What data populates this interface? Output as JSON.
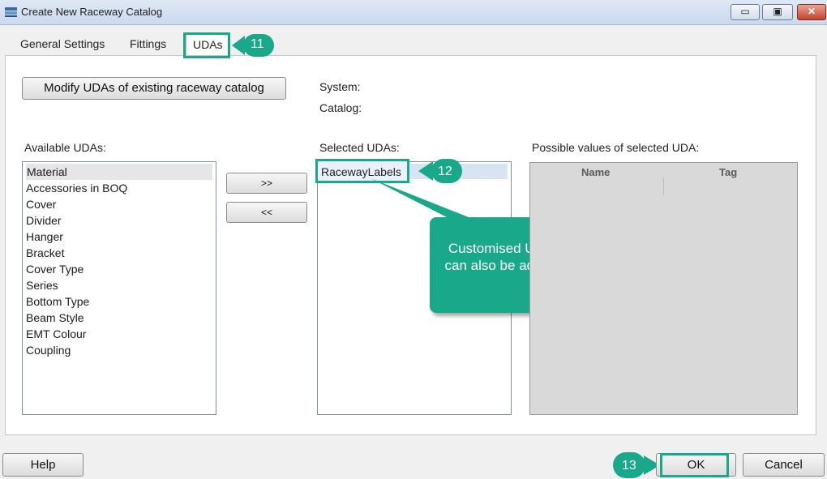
{
  "window": {
    "title": "Create New Raceway Catalog"
  },
  "window_controls": {
    "minimize": "▭",
    "maximize": "▣",
    "close": "✕"
  },
  "tabs": [
    {
      "label": "General Settings"
    },
    {
      "label": "Fittings"
    },
    {
      "label": "UDAs",
      "active": true
    }
  ],
  "modify_button": {
    "label": "Modify UDAs of existing raceway catalog"
  },
  "info": {
    "system_label": "System:",
    "catalog_label": "Catalog:"
  },
  "available": {
    "label": "Available UDAs:",
    "items": [
      "Material",
      "Accessories in BOQ",
      "Cover",
      "Divider",
      "Hanger",
      "Bracket",
      "Cover Type",
      "Series",
      "Bottom Type",
      "Beam Style",
      "EMT Colour",
      "Coupling"
    ],
    "selected_item": "Material"
  },
  "transfer": {
    "add_label": ">>",
    "remove_label": "<<"
  },
  "selected": {
    "label": "Selected UDAs:",
    "items": [
      "RacewayLabels"
    ]
  },
  "possible_values": {
    "label": "Possible values of selected UDA:",
    "columns": [
      "Name",
      "Tag"
    ]
  },
  "footer": {
    "help_label": "Help",
    "ok_label": "OK",
    "cancel_label": "Cancel"
  },
  "annotations": {
    "step_11": "11",
    "step_12": "12",
    "step_13": "13",
    "note": "Customised UDA can also be added",
    "accent_color": "#19a98a"
  }
}
